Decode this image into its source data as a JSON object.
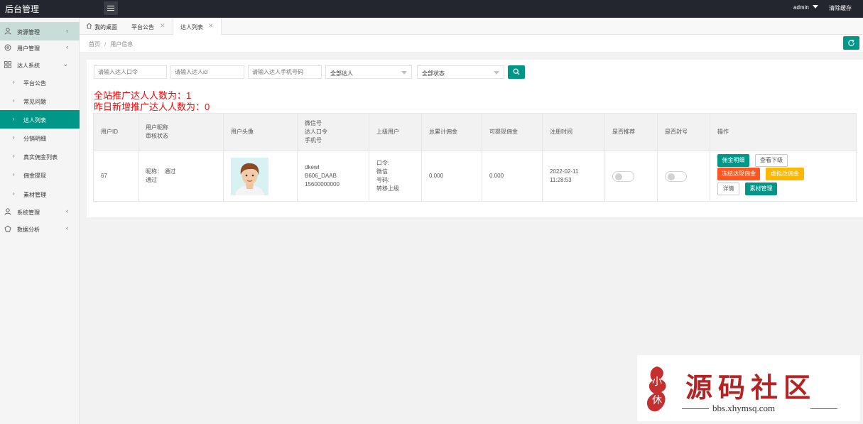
{
  "app": {
    "brand": "后台管理",
    "user": "admin",
    "clear_cache": "清除缓存"
  },
  "sidebar": {
    "items": [
      {
        "label": "资源管理",
        "icon": "user-icon",
        "arrow": "‹"
      },
      {
        "label": "用户管理",
        "icon": "globe-icon",
        "arrow": "‹"
      },
      {
        "label": "达人系统",
        "icon": "grid-icon",
        "arrow": "⌄"
      },
      {
        "label": "平台公告",
        "arrow": "›"
      },
      {
        "label": "常见问题",
        "arrow": "›"
      },
      {
        "label": "达人列表",
        "arrow": "›"
      },
      {
        "label": "分销明细",
        "arrow": "›"
      },
      {
        "label": "真实佣金列表",
        "arrow": "›"
      },
      {
        "label": "佣金提现",
        "arrow": "›"
      },
      {
        "label": "素材管理",
        "arrow": "›"
      },
      {
        "label": "系统管理",
        "icon": "user-icon",
        "arrow": "‹"
      },
      {
        "label": "数据分析",
        "icon": "chart-icon",
        "arrow": "‹"
      }
    ]
  },
  "tabs": [
    {
      "label": "我的桌面",
      "icon": "home-icon"
    },
    {
      "label": "平台公告",
      "close": "✕"
    },
    {
      "label": "达人列表",
      "close": "✕"
    }
  ],
  "breadcrumb": {
    "home": "首页",
    "separator": "/",
    "current": "用户信息"
  },
  "filters": {
    "code_placeholder": "请输入达人口令",
    "id_placeholder": "请输入达人id",
    "phone_placeholder": "请输入达人手机号码",
    "type_select": "全部达人",
    "status_select": "全部状态"
  },
  "stats": {
    "total": "全站推广达人人数为：1",
    "new_yesterday": "昨日新增推广达人人数为：0"
  },
  "table": {
    "headers": {
      "user_id": "用户ID",
      "nickname": "用户昵称",
      "audit": "审核状态",
      "avatar": "用户头像",
      "wechat": "微信号",
      "code": "达人口令",
      "phone": "手机号",
      "parent": "上级用户",
      "total_commission": "总累计佣金",
      "withdrawable": "可提现佣金",
      "register_time": "注册时间",
      "recommend": "是否推荐",
      "banned": "是否封号",
      "actions": "操作"
    },
    "row": {
      "user_id": "67",
      "nickname_line": "昵称：  通过",
      "audit_line": "通过",
      "wechat": "dkewl",
      "code": "B606_DAAB",
      "phone": "15600000000",
      "parent_code": "口令:",
      "parent_wechat": "微信",
      "parent_phone": "号码:",
      "parent_move": "转移上级",
      "total_commission": "0.000",
      "withdrawable": "0.000",
      "register_date": "2022-02-11",
      "register_clock": "11:28:53",
      "recommend_on": false,
      "banned_on": false
    },
    "actions": {
      "commission_detail": "佣金明细",
      "view_subordinates": "查看下级",
      "freeze_commission": "冻结达现佣金",
      "virtual_commission": "虚拟改佣金",
      "detail": "详情",
      "material": "素材管理"
    }
  },
  "watermark": {
    "title": "源码社区",
    "url": "bbs.xhymsq.com",
    "seal_text": "小 休"
  },
  "colors": {
    "accent": "#009688",
    "topbar": "#23262e",
    "danger": "#ff5722",
    "warn": "#ffb800",
    "stat_red": "#ff0000"
  }
}
